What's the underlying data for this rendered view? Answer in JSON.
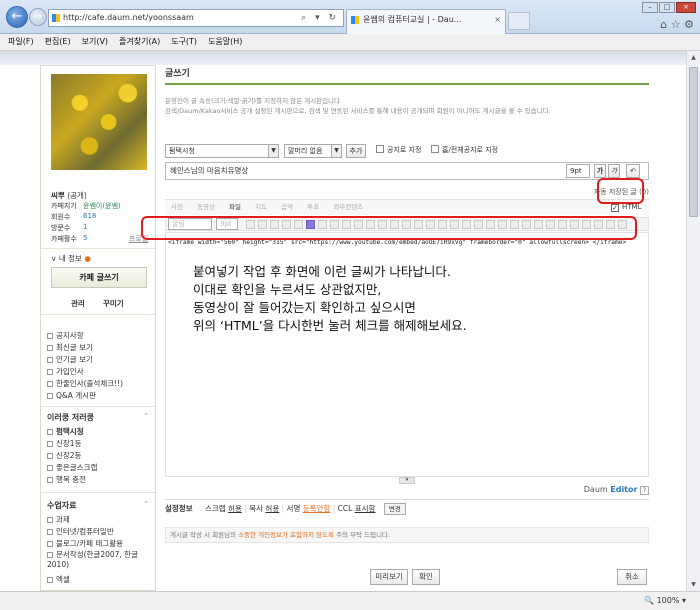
{
  "browser": {
    "url": "http://cafe.daum.net/yoonssaam",
    "tab_title": "윤쌤의 컴퓨터교실 | - Dau...",
    "back_icon": "←",
    "forward_icon": "→",
    "addr_icons": "⌕ ▾ ↻",
    "tab_close": "×",
    "right_icons": "⌂ ☆ ⚙",
    "win_min": "–",
    "win_max": "□",
    "win_close": "×"
  },
  "menubar": [
    "파일(F)",
    "편집(E)",
    "보기(V)",
    "즐겨찾기(A)",
    "도구(T)",
    "도움말(H)"
  ],
  "sidebar": {
    "level_label": "씨뿌",
    "level_value": "(공개)",
    "manager_label": "카페지기",
    "manager_value": "윤쌤이(윤쌤)",
    "members_label": "회원수",
    "members_value": "618",
    "visits_label": "방문수",
    "visits_value": "1",
    "posts_label": "카페활수",
    "posts_value": "5",
    "profile_link": "프로필",
    "my_info": "내 정보",
    "write_button": "카페 글쓰기",
    "manage_link": "관리",
    "decorate_link": "꾸미기",
    "menu1": [
      "공지사항",
      "최신글 보기",
      "인기글 보기",
      "가입인사",
      "한줄인사(출석체크!!)",
      "Q&A 게시판"
    ],
    "section2": "이러쿵 저러쿵",
    "menu2": [
      "펌택시청",
      "신장1등",
      "신장2등",
      "좋은글스크랩",
      "행복 충전"
    ],
    "section3": "수업자료",
    "menu3": [
      "과제",
      "인터넷/컴퓨터일반",
      "블로그/카페 태그활용",
      "문서작성(한글2007, 한글2010)",
      "엑셀"
    ],
    "caret": "⌃"
  },
  "main": {
    "title": "글쓰기",
    "notice1": "운영진이 글 속성(크기·색깔·굵기)를 지정하지 않은 게시판입니다.",
    "notice2": "검색/Daum/Kakao서비스 공개 설정된 게시판으로, 검색 및 연동된 서비스를 통해 내용이 공개되며 회원이 아니어도 게시글을 볼 수 있습니다.",
    "board_select": "펌택시청",
    "header_select": "말머리 없음",
    "add_button": "추가",
    "notice_checkbox": "공지로 지정",
    "all_notice_checkbox": "홈/전체공지로 지정",
    "subject": "혜민스님의 마음치유명상",
    "font_size": "9pt",
    "bold": "가",
    "italic": "가",
    "undo": "↶",
    "autosave": "자동 저장된 글 (0)",
    "attach": {
      "photo": "사진",
      "video": "동영상",
      "file": "파일",
      "map": "지도",
      "music": "음악",
      "vote": "투표",
      "external": "외부컨텐츠"
    },
    "html_checkbox": "HTML",
    "font_select": "굴림",
    "font_size2": "9pt",
    "code": "<iframe width=\"560\" height=\"315\" src=\"https://www.youtube.com/embed/aoOE7iR9xVg\" frameborder=\"0\" allowfullscreen> </iframe>",
    "annotation": [
      "붙여넣기 작업 후 화면에 이런 글씨가 나타납니다.",
      "이대로 확인을 누르셔도 상관없지만,",
      "동영상이 잘 들어갔는지 확인하고 싶으시면",
      "위의 ‘HTML’을 다시한번 눌러 체크를 해제해보세요."
    ],
    "resize_glyph": "▾",
    "daum_editor_prefix": "Daum",
    "daum_editor": "Editor",
    "help_mark": "?",
    "settings": {
      "label": "설정정보",
      "scrap": "스크랩",
      "scrap_val": "허용",
      "copy": "복사",
      "copy_val": "허용",
      "sign": "서명",
      "sign_val": "등록안함",
      "ccl": "CCL",
      "ccl_val": "표시함",
      "change": "변경"
    },
    "privacy_prefix": "게시글 작성 시 회원님의",
    "privacy_emph": "소중한 개인정보가 포함하지 않도록",
    "privacy_suffix": "주의 부탁 드립니다.",
    "preview_button": "미리보기",
    "confirm_button": "확인",
    "cancel_button": "취소"
  },
  "status": {
    "zoom": "100%"
  },
  "colors": {
    "accent_green": "#7aa04a",
    "highlight_red": "#e01c1c",
    "link_blue": "#2a7ab8"
  }
}
